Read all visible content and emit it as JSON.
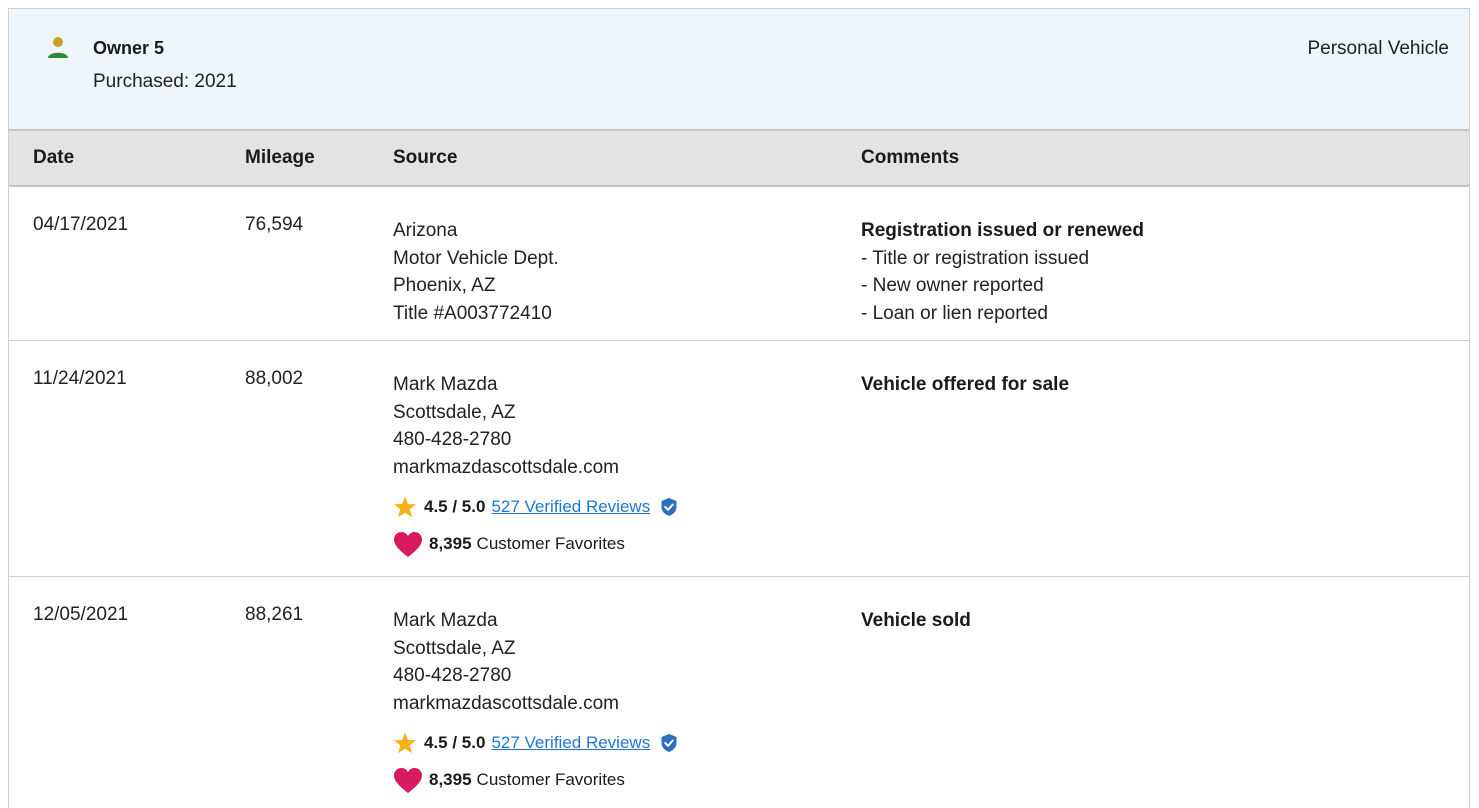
{
  "owner": {
    "name": "Owner 5",
    "purchased": "Purchased: 2021",
    "type": "Personal Vehicle",
    "icon": "person-icon",
    "icon_colors": {
      "head": "#c9a227",
      "body": "#2e8b3a"
    }
  },
  "table": {
    "headers": {
      "date": "Date",
      "mileage": "Mileage",
      "source": "Source",
      "comments": "Comments"
    },
    "rows": [
      {
        "date": "04/17/2021",
        "mileage": "76,594",
        "source": [
          "Arizona",
          "Motor Vehicle Dept.",
          "Phoenix, AZ",
          "Title #A003772410"
        ],
        "comment_title": "Registration issued or renewed",
        "comment_items": [
          "- Title or registration issued",
          "- New owner reported",
          "- Loan or lien reported"
        ]
      },
      {
        "date": "11/24/2021",
        "mileage": "88,002",
        "source": [
          "Mark Mazda",
          "Scottsdale, AZ",
          "480-428-2780",
          "markmazdascottsdale.com"
        ],
        "rating": {
          "score": "4.5 / 5.0",
          "reviews": "527 Verified Reviews",
          "favorites_count": "8,395",
          "favorites_label": "Customer Favorites"
        },
        "comment_title": "Vehicle offered for sale"
      },
      {
        "date": "12/05/2021",
        "mileage": "88,261",
        "source": [
          "Mark Mazda",
          "Scottsdale, AZ",
          "480-428-2780",
          "markmazdascottsdale.com"
        ],
        "rating": {
          "score": "4.5 / 5.0",
          "reviews": "527 Verified Reviews",
          "favorites_count": "8,395",
          "favorites_label": "Customer Favorites"
        },
        "comment_title": "Vehicle sold"
      }
    ]
  },
  "icons": {
    "rating": "star-icon",
    "verified": "verified-shield-icon",
    "favorites": "heart-icon"
  },
  "colors": {
    "link": "#1f76d2",
    "star": "#f6b21b",
    "heart": "#d81b60",
    "verified": "#2f6fc2",
    "header_bg": "#eef5fb",
    "table_head_bg": "#e3e3e3"
  }
}
